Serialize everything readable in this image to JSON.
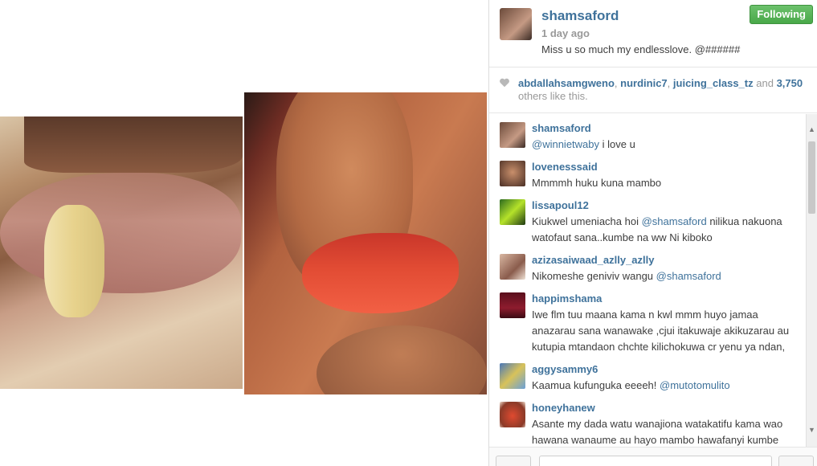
{
  "post": {
    "username": "shamsaford",
    "time_ago": "1 day ago",
    "caption": "Miss u so much my endlesslove. @######",
    "follow_label": "Following"
  },
  "likes": {
    "user1": "abdallahsamgweno",
    "user2": "nurdinic7",
    "user3": "juicing_class_tz",
    "and_text": "and",
    "count": "3,750",
    "others_text": "others like this."
  },
  "comments": [
    {
      "user": "shamsaford",
      "text": "",
      "mention": "@winnietwaby",
      "suffix": " i love u"
    },
    {
      "user": "lovenesssaid",
      "text": "Mmmmh huku kuna mambo",
      "mention": "",
      "suffix": ""
    },
    {
      "user": "lissapoul12",
      "text": "Kiukwel umeniacha hoi ",
      "mention": "@shamsaford",
      "suffix": " nilikua nakuona watofaut sana..kumbe na ww Ni kiboko"
    },
    {
      "user": "azizasaiwaad_azlly_azlly",
      "text": "Nikomeshe geniviv wangu ",
      "mention": "@shamsaford",
      "suffix": ""
    },
    {
      "user": "happimshama",
      "text": "Iwe flm tuu maana kama n kwl mmm huyo jamaa anazarau sana wanawake ,cjui itakuwaje akikuzarau au kutupia mtandaon chchte kilichokuwa cr yenu ya ndan,",
      "mention": "",
      "suffix": ""
    },
    {
      "user": "aggysammy6",
      "text": "Kaamua kufunguka eeeeh! ",
      "mention": "@mutotomulito",
      "suffix": ""
    },
    {
      "user": "honeyhanew",
      "text": "Asante my dada watu wanajiona watakatifu kama wao hawana wanaume au hayo mambo hawafanyi kumbe",
      "mention": "",
      "suffix": ""
    }
  ],
  "icons": {
    "heart": "heart-icon",
    "scroll_up": "chevron-up-icon",
    "scroll_down": "chevron-down-icon"
  },
  "colors": {
    "link": "#3f729b",
    "follow": "#5cb85c"
  }
}
